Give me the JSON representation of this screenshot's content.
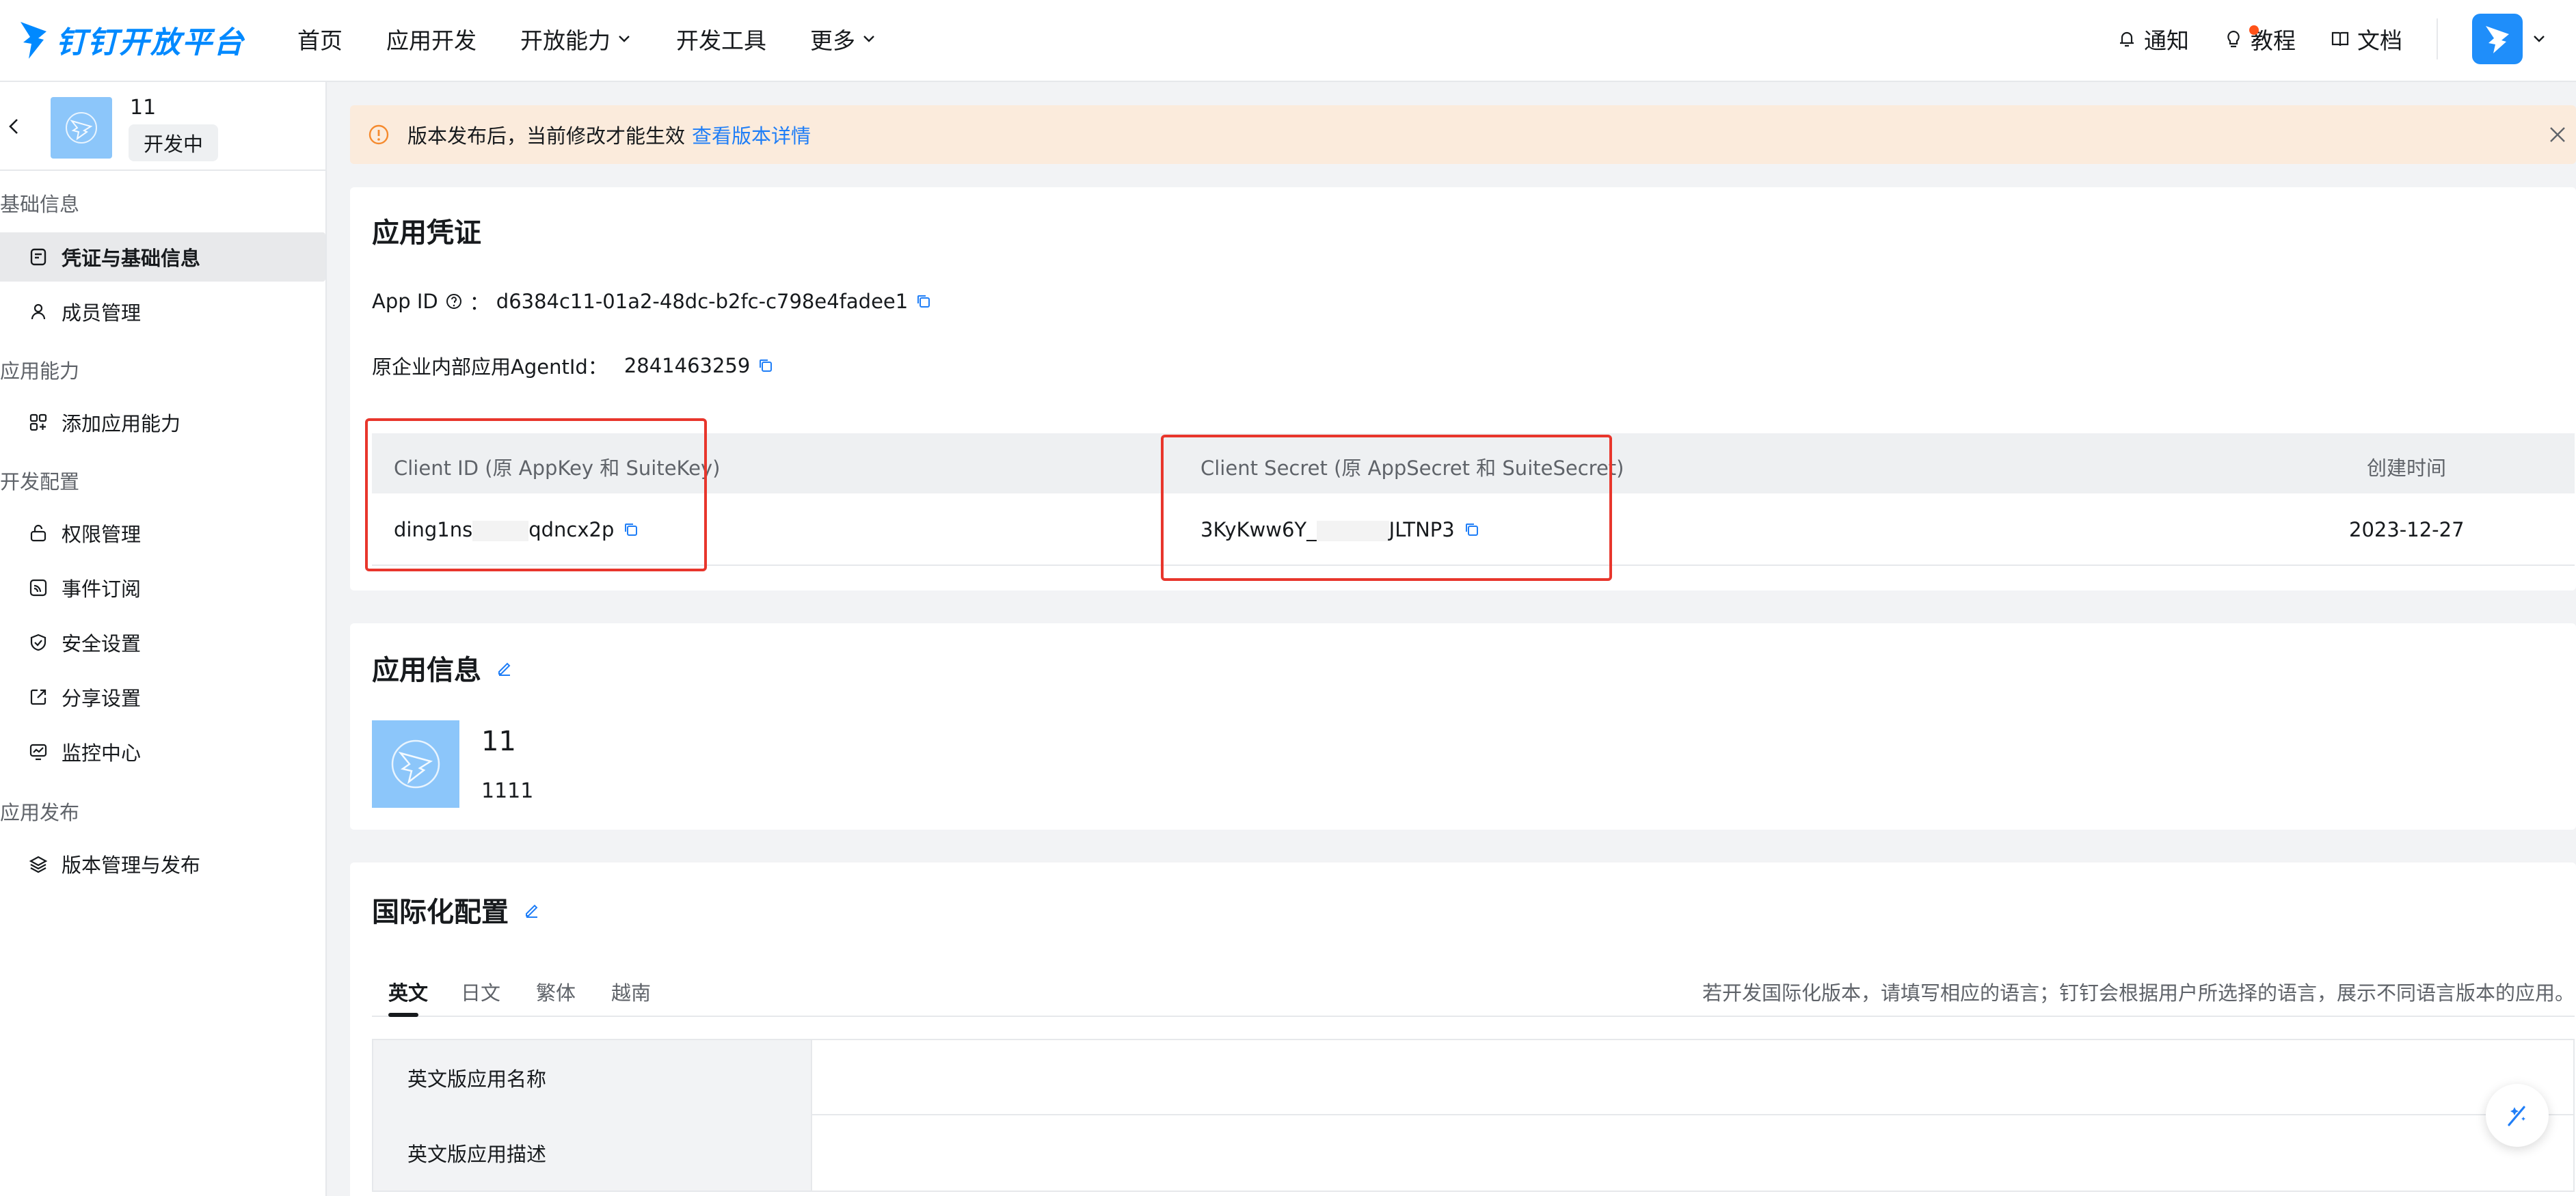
{
  "header": {
    "logo_text": "钉钉开放平台",
    "nav": [
      {
        "label": "首页"
      },
      {
        "label": "应用开发"
      },
      {
        "label": "开放能力"
      },
      {
        "label": "开发工具"
      },
      {
        "label": "更多"
      }
    ],
    "notify_label": "通知",
    "tutorial_label": "教程",
    "docs_label": "文档"
  },
  "sidebar": {
    "app_name": "11",
    "app_status": "开发中",
    "groups": {
      "basic": "基础信息",
      "capability": "应用能力",
      "dev_config": "开发配置",
      "release": "应用发布"
    },
    "items": {
      "credentials": "凭证与基础信息",
      "members": "成员管理",
      "add_capability": "添加应用能力",
      "permissions": "权限管理",
      "events": "事件订阅",
      "security": "安全设置",
      "share": "分享设置",
      "monitor": "监控中心",
      "versions": "版本管理与发布"
    }
  },
  "banner": {
    "text": "版本发布后，当前修改才能生效",
    "link": "查看版本详情"
  },
  "credentials": {
    "title": "应用凭证",
    "app_id_label": "App ID",
    "app_id_sep": "：",
    "app_id": "d6384c11-01a2-48dc-b2fc-c798e4fadee1",
    "agent_label": "原企业内部应用AgentId：",
    "agent_id": "2841463259",
    "col_client_id": "Client ID (原 AppKey 和 SuiteKey)",
    "col_client_secret": "Client Secret (原 AppSecret 和 SuiteSecret)",
    "col_created": "创建时间",
    "client_id_start": "ding1ns",
    "client_id_end": "qdncx2p",
    "client_secret_start": "3KyKww6Y_",
    "client_secret_end": "JLTNP3",
    "created": "2023-12-27"
  },
  "app_info": {
    "title": "应用信息",
    "name": "11",
    "description": "1111"
  },
  "i18n": {
    "title": "国际化配置",
    "tabs": [
      "英文",
      "日文",
      "繁体",
      "越南"
    ],
    "hint": "若开发国际化版本，请填写相应的语言；钉钉会根据用户所选择的语言，展示不同语言版本的应用。",
    "rows": [
      {
        "label": "英文版应用名称"
      },
      {
        "label": "英文版应用描述"
      }
    ]
  },
  "colors": {
    "brand": "#0089ff",
    "link": "#1f7ef7",
    "highlight_box": "#e8362c",
    "banner_bg": "#fbebdc"
  }
}
